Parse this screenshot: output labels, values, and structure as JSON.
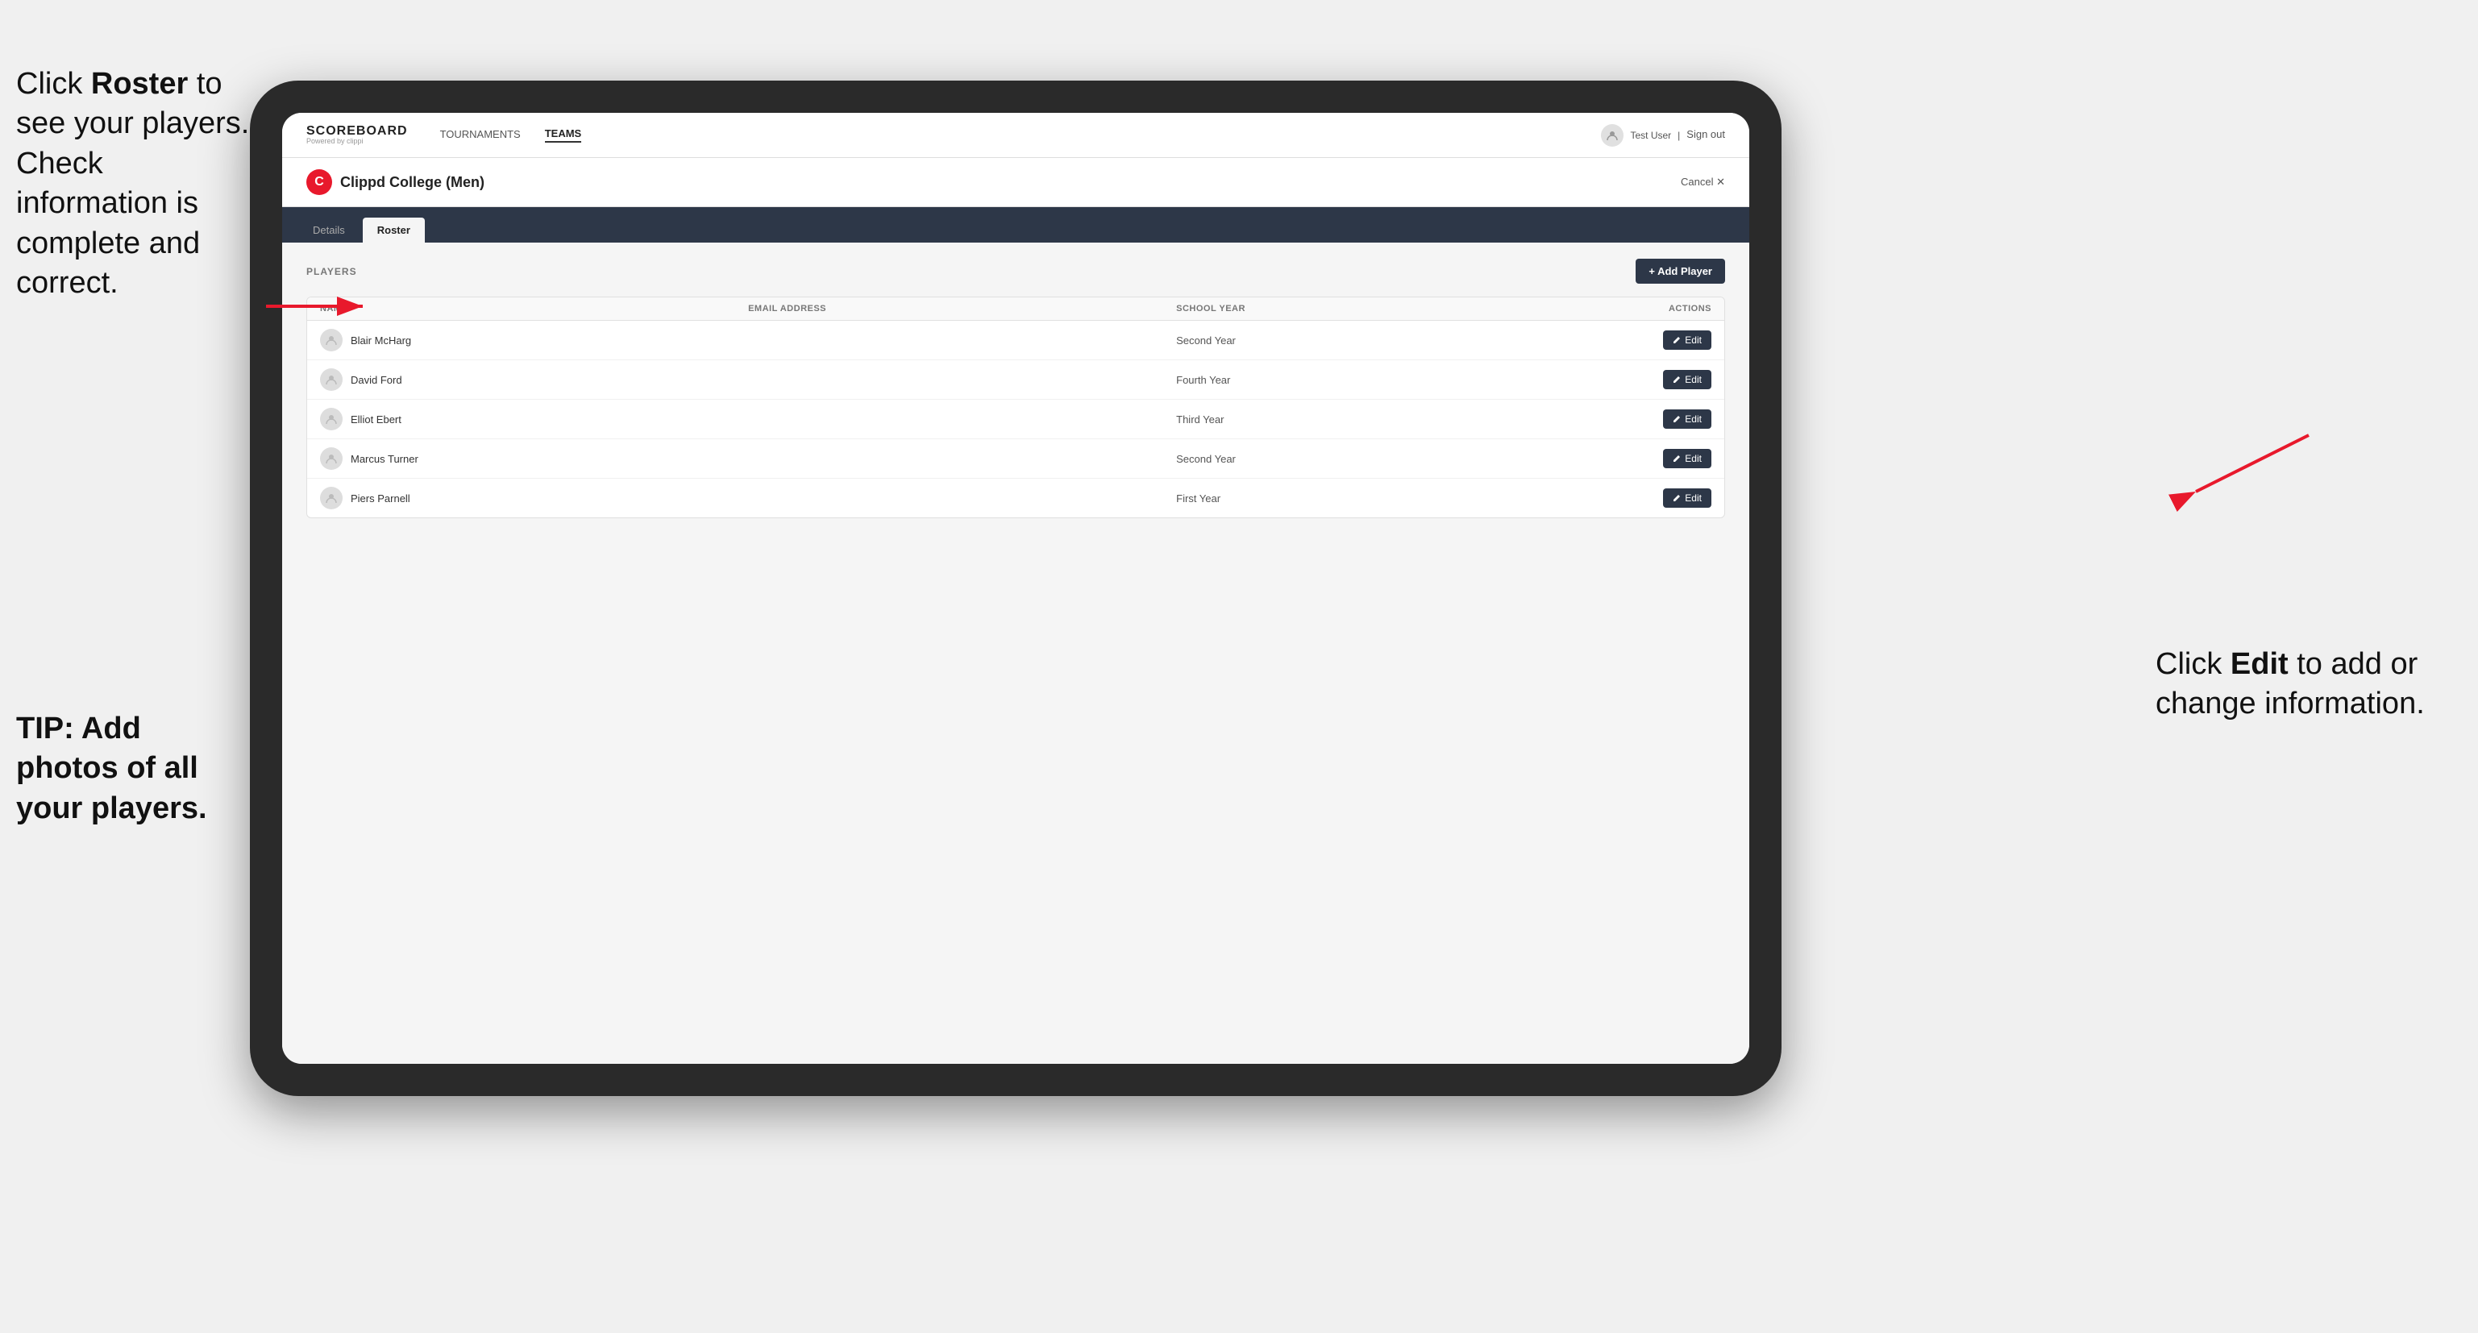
{
  "instructions": {
    "left_line1": "Click ",
    "left_bold1": "Roster",
    "left_line2": " to see your players. Check information is complete and correct.",
    "tip": "TIP: Add photos of all your players.",
    "right_line1": "Click ",
    "right_bold1": "Edit",
    "right_line2": " to add or change information."
  },
  "nav": {
    "logo": "SCOREBOARD",
    "logo_sub": "Powered by clippi",
    "links": [
      "TOURNAMENTS",
      "TEAMS"
    ],
    "active_link": "TEAMS",
    "user": "Test User",
    "sign_out": "Sign out"
  },
  "team": {
    "logo_letter": "C",
    "name": "Clippd College (Men)",
    "cancel": "Cancel ✕"
  },
  "tabs": [
    {
      "label": "Details",
      "active": false
    },
    {
      "label": "Roster",
      "active": true
    }
  ],
  "players_section": {
    "label": "PLAYERS",
    "add_button": "+ Add Player"
  },
  "table": {
    "headers": [
      "NAME",
      "EMAIL ADDRESS",
      "SCHOOL YEAR",
      "ACTIONS"
    ],
    "rows": [
      {
        "name": "Blair McHarg",
        "email": "",
        "school_year": "Second Year",
        "action": "Edit"
      },
      {
        "name": "David Ford",
        "email": "",
        "school_year": "Fourth Year",
        "action": "Edit"
      },
      {
        "name": "Elliot Ebert",
        "email": "",
        "school_year": "Third Year",
        "action": "Edit"
      },
      {
        "name": "Marcus Turner",
        "email": "",
        "school_year": "Second Year",
        "action": "Edit"
      },
      {
        "name": "Piers Parnell",
        "email": "",
        "school_year": "First Year",
        "action": "Edit"
      }
    ]
  }
}
